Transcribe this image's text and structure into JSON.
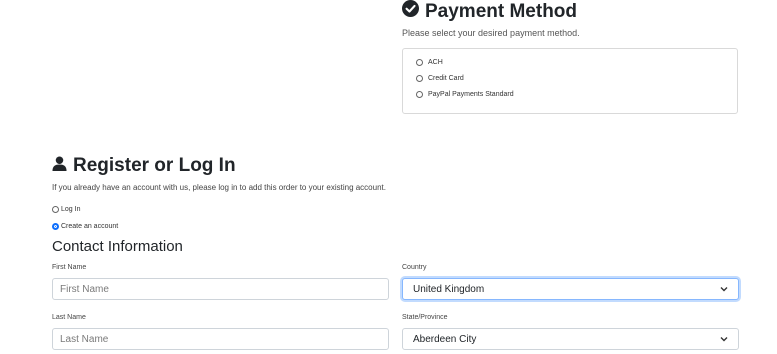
{
  "payment": {
    "title": "Payment Method",
    "subtitle": "Please select your desired payment method.",
    "options": [
      {
        "label": "ACH",
        "checked": false
      },
      {
        "label": "Credit Card",
        "checked": false
      },
      {
        "label": "PayPal Payments Standard",
        "checked": false
      }
    ]
  },
  "register": {
    "title": "Register or Log In",
    "subtitle": "If you already have an account with us, please log in to add this order to your existing account.",
    "options": [
      {
        "label": "Log In",
        "checked": false
      },
      {
        "label": "Create an account",
        "checked": true
      }
    ]
  },
  "contact": {
    "title": "Contact Information",
    "first_name": {
      "label": "First Name",
      "placeholder": "First Name",
      "value": ""
    },
    "last_name": {
      "label": "Last Name",
      "placeholder": "Last Name",
      "value": ""
    },
    "country": {
      "label": "Country",
      "value": "United Kingdom"
    },
    "state": {
      "label": "State/Province",
      "value": "Aberdeen City"
    }
  },
  "icons": {
    "payment": "check-circle-icon",
    "register": "user-icon",
    "select": "chevron-down-icon"
  },
  "colors": {
    "accent": "#0d6efd",
    "focus_border": "#86b7fe"
  }
}
